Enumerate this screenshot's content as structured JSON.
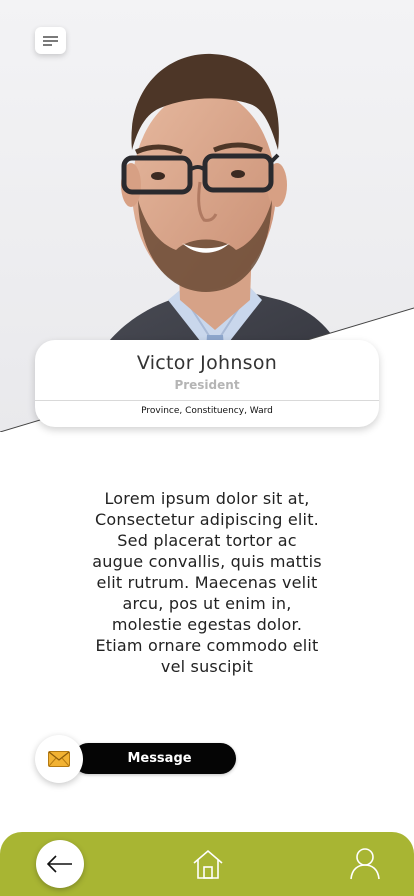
{
  "profile": {
    "name": "Victor Johnson",
    "role": "President",
    "location": "Province, Constituency, Ward"
  },
  "bio": {
    "text": "Lorem ipsum dolor sit at, Consectetur adipiscing elit. Sed placerat tortor ac augue convallis, quis mattis elit rutrum. Maecenas velit arcu, pos ut enim in, molestie egestas dolor. Etiam ornare commodo elit vel suscipit"
  },
  "actions": {
    "message_label": "Message",
    "message_icon": "envelope-icon"
  },
  "nav": {
    "items": [
      "back-arrow-icon",
      "home-icon",
      "user-icon"
    ]
  },
  "colors": {
    "accent": "#a8b533",
    "message_pill": "#050505",
    "envelope": "#f2b233"
  }
}
